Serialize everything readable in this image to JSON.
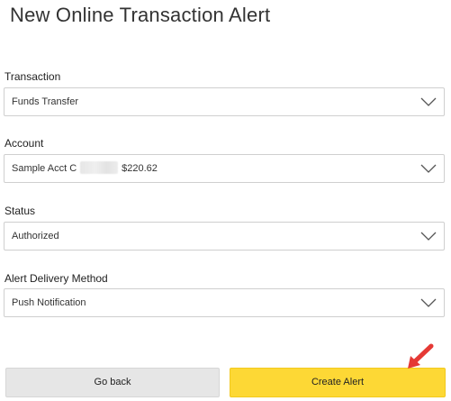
{
  "page": {
    "title": "New Online Transaction Alert"
  },
  "form": {
    "transaction": {
      "label": "Transaction",
      "value": "Funds Transfer"
    },
    "account": {
      "label": "Account",
      "value_prefix": "Sample Acct C",
      "balance": "$220.62"
    },
    "status": {
      "label": "Status",
      "value": "Authorized"
    },
    "delivery": {
      "label": "Alert Delivery Method",
      "value": "Push Notification"
    }
  },
  "buttons": {
    "back_label": "Go back",
    "create_label": "Create Alert"
  },
  "colors": {
    "primary_button": "#fdd835",
    "secondary_button": "#e6e6e6",
    "annotation_arrow": "#e53935"
  },
  "icons": {
    "dropdown": "chevron-down-icon",
    "annotation": "red-arrow-icon"
  }
}
